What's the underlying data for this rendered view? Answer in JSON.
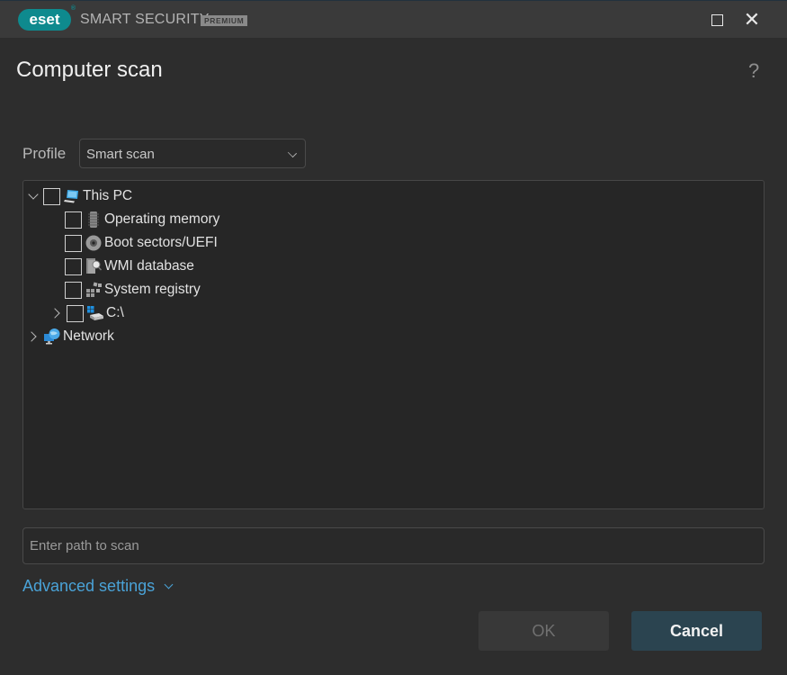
{
  "window": {
    "brand": "eset",
    "product_name": "SMART SECURITY",
    "edition_badge": "PREMIUM",
    "maximize_icon": "maximize-icon",
    "close_icon": "close-icon",
    "accent_color": "#0e8a8e"
  },
  "header": {
    "title": "Computer scan",
    "help_label": "?"
  },
  "profile": {
    "label": "Profile",
    "selected": "Smart scan"
  },
  "tree": {
    "root": {
      "label": "This PC",
      "icon": "computer-icon",
      "expanded": true,
      "checked": false,
      "children": [
        {
          "label": "Operating memory",
          "icon": "memory-chip-icon",
          "checked": false
        },
        {
          "label": "Boot sectors/UEFI",
          "icon": "disc-icon",
          "checked": false
        },
        {
          "label": "WMI database",
          "icon": "wmi-database-icon",
          "checked": false
        },
        {
          "label": "System registry",
          "icon": "registry-icon",
          "checked": false
        },
        {
          "label": "C:\\",
          "icon": "windows-drive-icon",
          "checked": false,
          "expandable": true,
          "expanded": false
        }
      ]
    },
    "network": {
      "label": "Network",
      "icon": "network-globe-icon",
      "expanded": false
    }
  },
  "path_input": {
    "value": "",
    "placeholder": "Enter path to scan"
  },
  "advanced_settings": {
    "label": "Advanced settings",
    "link_color": "#4aa3d8"
  },
  "buttons": {
    "ok": "OK",
    "ok_enabled": false,
    "cancel": "Cancel"
  }
}
